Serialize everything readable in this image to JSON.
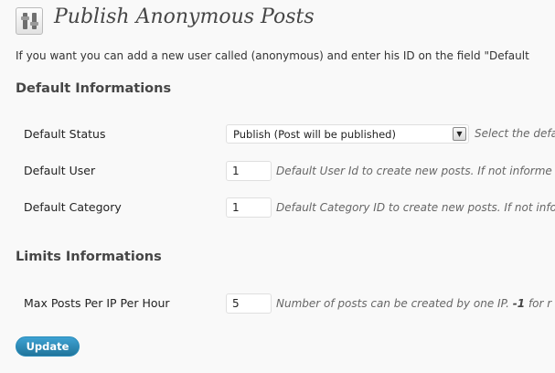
{
  "header": {
    "icon": "settings-sliders-icon",
    "title": "Publish Anonymous Posts"
  },
  "intro": "If you want you can add a new user called (anonymous) and enter his ID on the field \"Default",
  "defaults": {
    "title": "Default Informations",
    "status_label": "Default Status",
    "status_value": "Publish (Post will be published)",
    "status_hint": "Select the defa",
    "user_label": "Default User",
    "user_value": "1",
    "user_hint": "Default User Id to create new posts. If not informe",
    "category_label": "Default Category",
    "category_value": "1",
    "category_hint": "Default Category ID to create new posts. If not info"
  },
  "limits": {
    "title": "Limits Informations",
    "max_label": "Max Posts Per IP Per Hour",
    "max_value": "5",
    "max_hint_pre": "Number of posts can be created by one IP. ",
    "max_hint_strong": "-1",
    "max_hint_post": " for r"
  },
  "actions": {
    "update_label": "Update"
  },
  "colors": {
    "accent": "#21759b",
    "background": "#f9f9f9"
  }
}
